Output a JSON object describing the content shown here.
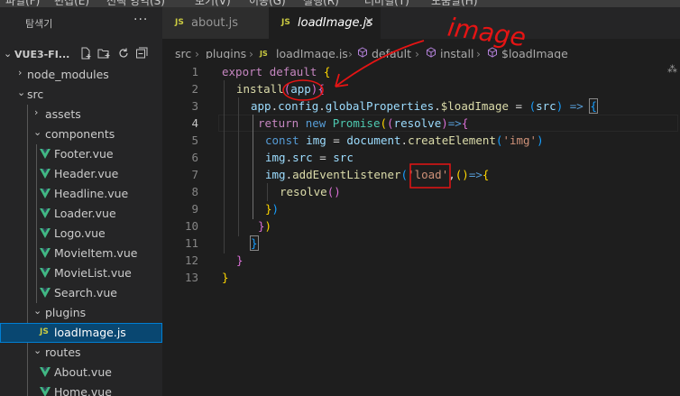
{
  "menubar": {
    "items": [
      "파일(F)",
      "편집(E)",
      "선택 영역(S)",
      "보기(V)",
      "이동(G)",
      "실행(R)",
      "터미널(T)",
      "도움말(H)"
    ]
  },
  "sidebar": {
    "title": "탐색기",
    "more": "···",
    "project": "VUE3-FI...",
    "tree": [
      {
        "label": "node_modules",
        "kind": "folder",
        "expanded": false
      },
      {
        "label": "src",
        "kind": "folder",
        "expanded": true
      },
      {
        "label": "assets",
        "kind": "folder",
        "expanded": false
      },
      {
        "label": "components",
        "kind": "folder",
        "expanded": true
      },
      {
        "label": "Footer.vue",
        "kind": "vue"
      },
      {
        "label": "Header.vue",
        "kind": "vue"
      },
      {
        "label": "Headline.vue",
        "kind": "vue"
      },
      {
        "label": "Loader.vue",
        "kind": "vue"
      },
      {
        "label": "Logo.vue",
        "kind": "vue"
      },
      {
        "label": "MovieItem.vue",
        "kind": "vue"
      },
      {
        "label": "MovieList.vue",
        "kind": "vue"
      },
      {
        "label": "Search.vue",
        "kind": "vue"
      },
      {
        "label": "plugins",
        "kind": "folder",
        "expanded": true
      },
      {
        "label": "loadImage.js",
        "kind": "js",
        "selected": true
      },
      {
        "label": "routes",
        "kind": "folder",
        "expanded": true
      },
      {
        "label": "About.vue",
        "kind": "vue"
      },
      {
        "label": "Home.vue",
        "kind": "vue"
      }
    ]
  },
  "tabs": [
    {
      "badge": "JS",
      "label": "about.js",
      "active": false
    },
    {
      "badge": "JS",
      "label": "loadImage.js",
      "active": true,
      "close": "×"
    }
  ],
  "breadcrumb": {
    "parts": [
      "src",
      "plugins",
      "loadImage.js",
      "default",
      "install",
      "$loadImage"
    ],
    "sep": "›",
    "js_badge": "JS"
  },
  "editor": {
    "line_numbers": [
      "1",
      "2",
      "3",
      "4",
      "5",
      "6",
      "7",
      "8",
      "9",
      "10",
      "11",
      "12",
      "13"
    ],
    "active_line": 4
  },
  "annotation": {
    "text": "image",
    "color": "#e51414"
  }
}
